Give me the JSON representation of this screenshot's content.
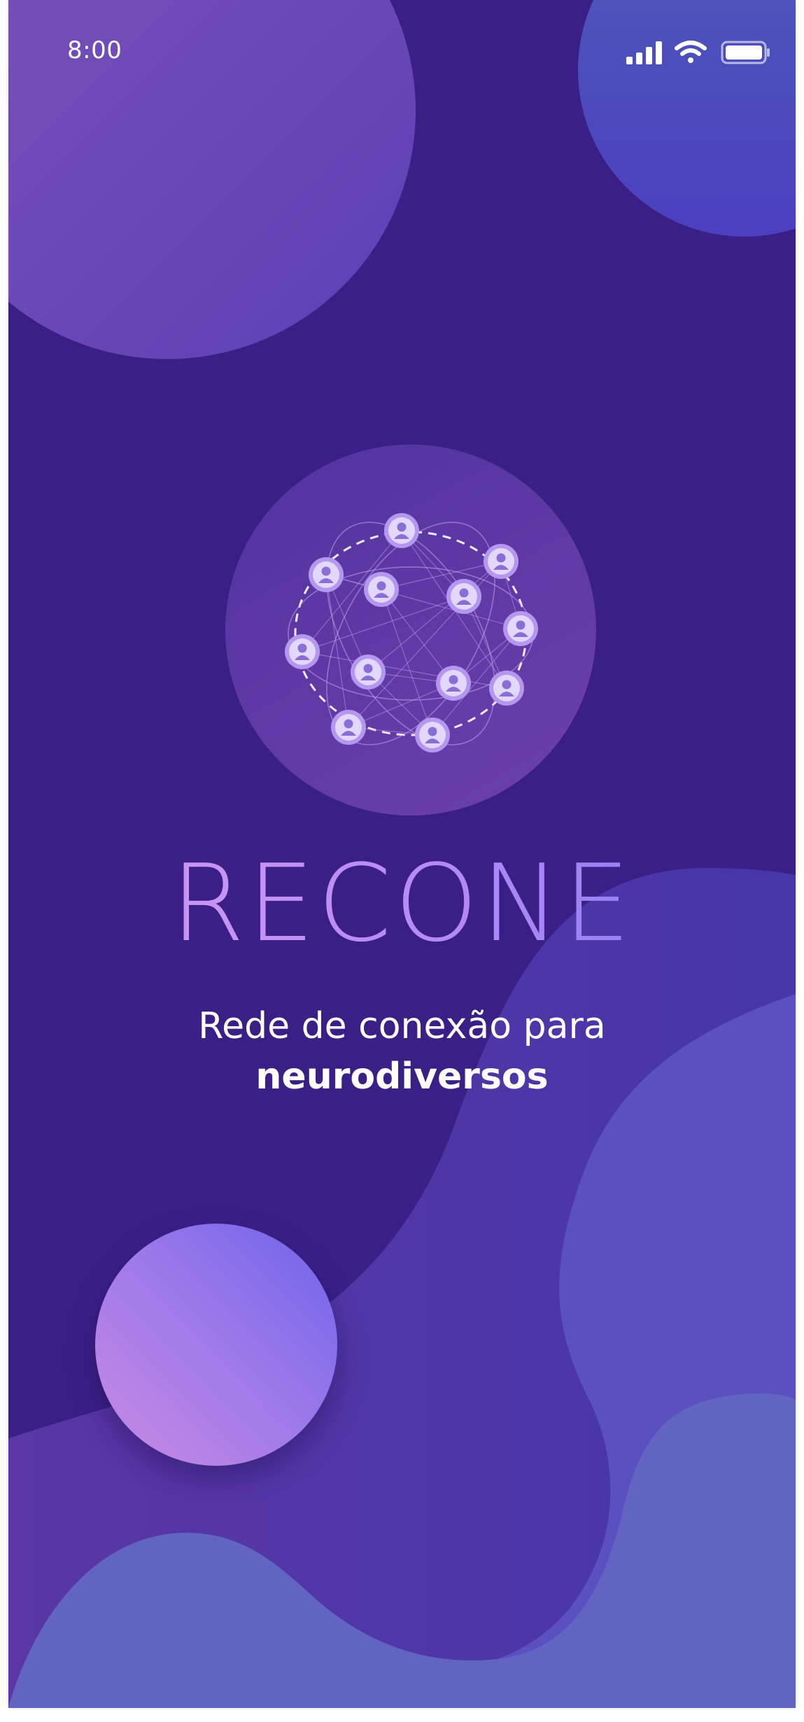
{
  "status_bar": {
    "time": "8:00",
    "icons": [
      "signal-icon",
      "wifi-icon",
      "battery-icon"
    ]
  },
  "logo": {
    "icon": "people-network-icon"
  },
  "app": {
    "title": "RECONE",
    "tagline_line1": "Rede de conexão para",
    "tagline_line2": "neurodiversos"
  },
  "action": {
    "icon": "gradient-circle-button"
  },
  "colors": {
    "background": "#3a1f87",
    "accent_purple": "#b48af7",
    "accent_blue": "#5a4fc4",
    "text": "#ffffff"
  }
}
